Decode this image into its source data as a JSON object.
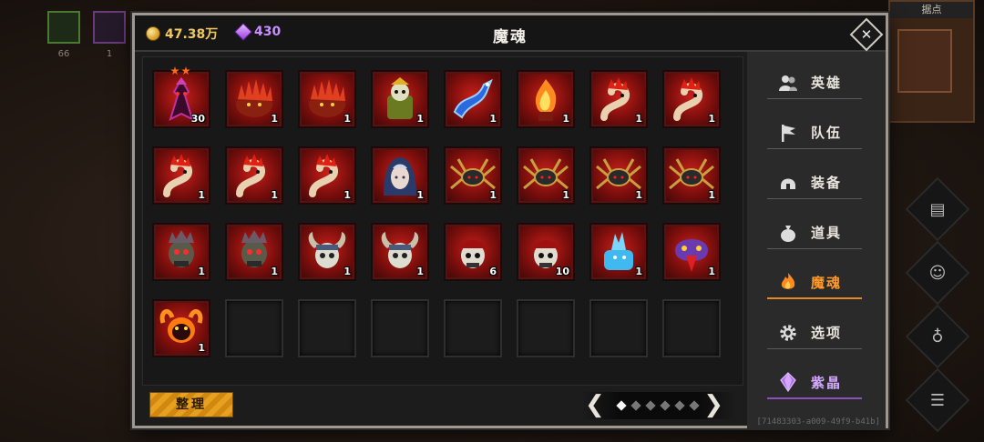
{
  "background": {
    "top_slots": [
      {
        "count": "66"
      },
      {
        "count": "1"
      }
    ],
    "minimap_label": "据点"
  },
  "window": {
    "title": "魔魂",
    "gold": "47.38万",
    "gems": "430"
  },
  "colors": {
    "accent_active": "#ff9a2a",
    "crystal": "#d4a8ff",
    "sort_button": "#e8a020"
  },
  "souls": [
    {
      "icon": "demon-knight",
      "count": "30",
      "stars": 2
    },
    {
      "icon": "red-spiked-beast",
      "count": "1"
    },
    {
      "icon": "red-spiked-beast",
      "count": "1"
    },
    {
      "icon": "golden-lich",
      "count": "1"
    },
    {
      "icon": "blue-dragon",
      "count": "1"
    },
    {
      "icon": "fire-elemental",
      "count": "1"
    },
    {
      "icon": "red-worm",
      "count": "1"
    },
    {
      "icon": "red-worm",
      "count": "1"
    },
    {
      "icon": "red-worm",
      "count": "1"
    },
    {
      "icon": "red-worm",
      "count": "1"
    },
    {
      "icon": "red-worm",
      "count": "1"
    },
    {
      "icon": "elf-hooded",
      "count": "1"
    },
    {
      "icon": "dark-spider",
      "count": "1"
    },
    {
      "icon": "dark-spider",
      "count": "1"
    },
    {
      "icon": "dark-spider",
      "count": "1"
    },
    {
      "icon": "dark-spider",
      "count": "1"
    },
    {
      "icon": "crowned-skull",
      "count": "1"
    },
    {
      "icon": "crowned-skull",
      "count": "1"
    },
    {
      "icon": "horned-skull-white",
      "count": "1"
    },
    {
      "icon": "horned-skull-white",
      "count": "1"
    },
    {
      "icon": "red-bandana-skull",
      "count": "6"
    },
    {
      "icon": "red-bandana-skull",
      "count": "10"
    },
    {
      "icon": "ice-golem",
      "count": "1"
    },
    {
      "icon": "purple-serpent",
      "count": "1"
    },
    {
      "icon": "fire-demon-skull",
      "count": "1"
    },
    {
      "icon": "empty"
    },
    {
      "icon": "empty"
    },
    {
      "icon": "empty"
    },
    {
      "icon": "empty"
    },
    {
      "icon": "empty"
    },
    {
      "icon": "empty"
    },
    {
      "icon": "empty"
    }
  ],
  "footer": {
    "sort_label": "整理",
    "prev_arrow": "❮",
    "next_arrow": "❯",
    "pages_total": 6,
    "page_current": 1
  },
  "menu": [
    {
      "label": "英雄",
      "icon": "heroes-icon"
    },
    {
      "label": "队伍",
      "icon": "flag-icon"
    },
    {
      "label": "装备",
      "icon": "helmet-icon"
    },
    {
      "label": "道具",
      "icon": "bag-icon"
    },
    {
      "label": "魔魂",
      "icon": "flame-icon",
      "active": true
    },
    {
      "label": "选项",
      "icon": "gear-icon"
    },
    {
      "label": "紫晶",
      "icon": "crystal-icon"
    }
  ],
  "uid": "[71483303-a009-49f9-b41b]"
}
